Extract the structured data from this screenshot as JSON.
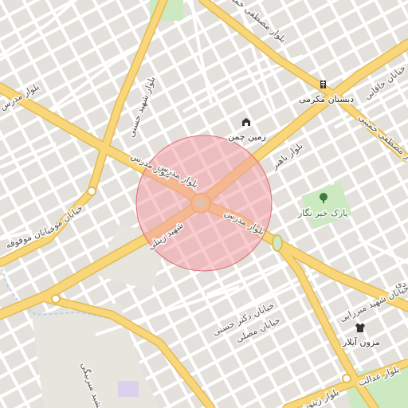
{
  "map": {
    "colors": {
      "background": "#f2efe9",
      "block": "#e4e1dc",
      "minor_road": "#ffffff",
      "major_road": "#f9d67a",
      "major_road_casing": "#e3bb52",
      "park": "#cde9c2",
      "water": "#a9cdf0",
      "highlight_fill": "#f2a0a5",
      "highlight_stroke": "#e06a72"
    },
    "highlight_circle": {
      "shown": true
    },
    "streets": {
      "modarres_upper": "بلوار مدرس",
      "modarres_left": "بلوار مدرس",
      "modarres_center": "بلوار مدرس",
      "modarres_lower": "بلوار مدرس",
      "shahid_zeynali": "شهید زینلی",
      "bahonar": "بلوار باهنر",
      "mostafa_khomeini_top": "بلوار مصطفی خمینی",
      "mostafa_khomeini_right": "بلوار مصطفی خمینی",
      "shahid_hasani": "بلوار شهید حسنی",
      "khaghani": "خیابان خاقانی",
      "movahed": "خیابان موحد",
      "movaghofeh": "خیابان موقوفه",
      "dr_hasani": "خیابان دکتر حسنی",
      "mosalla": "خیابان مصلی",
      "mirzaei": "خیابان شهید میرزایی",
      "edalat": "بلوار عدالت",
      "zeytoon": "بلوار زیتون",
      "jamshid_mirbeygi": "جمشید میربیگی",
      "partial_right": "دی"
    },
    "pois": {
      "school": {
        "label": "دبستان مکرمی",
        "icon": "school-icon"
      },
      "field": {
        "label": "زمین چمن",
        "icon": "field-icon"
      },
      "park": {
        "label": "پارک خیر نگار",
        "icon": "tree-icon"
      },
      "museum": {
        "label": "مزون آیلار",
        "icon": "shirt-icon"
      }
    }
  }
}
